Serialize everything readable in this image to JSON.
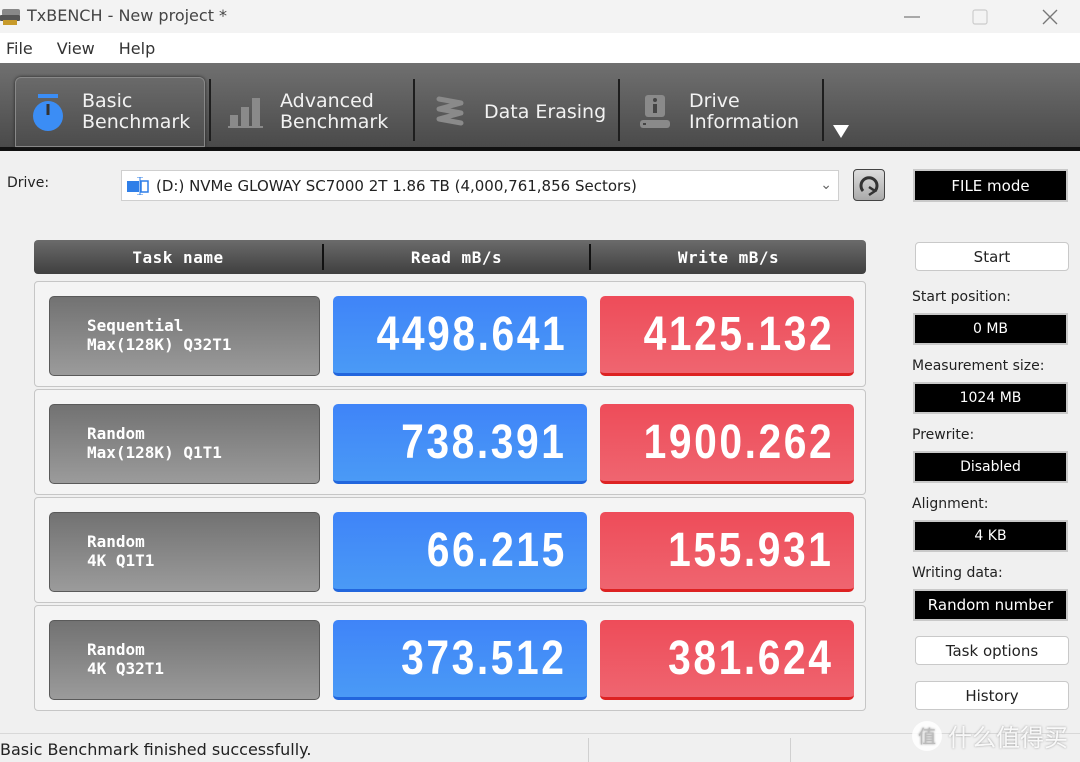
{
  "window": {
    "title": "TxBENCH - New project *",
    "minimize_icon": "minimize-icon",
    "maximize_icon": "maximize-icon",
    "close_icon": "close-icon"
  },
  "menu": [
    "File",
    "View",
    "Help"
  ],
  "tabs": [
    {
      "label_line1": "Basic",
      "label_line2": "Benchmark",
      "icon": "stopwatch-icon",
      "active": true
    },
    {
      "label_line1": "Advanced",
      "label_line2": "Benchmark",
      "icon": "bar-chart-icon",
      "active": false
    },
    {
      "label_line1": "Data Erasing",
      "label_line2": "",
      "icon": "eraser-spring-icon",
      "active": false
    },
    {
      "label_line1": "Drive",
      "label_line2": "Information",
      "icon": "drive-info-icon",
      "active": false
    }
  ],
  "drive": {
    "label": "Drive:",
    "selected": "(D:) NVMe GLOWAY SC7000 2T  1.86 TB (4,000,761,856 Sectors)",
    "mode": "FILE mode"
  },
  "table": {
    "headers": [
      "Task name",
      "Read mB/s",
      "Write mB/s"
    ],
    "rows": [
      {
        "name_line1": "Sequential",
        "name_line2": "Max(128K) Q32T1",
        "read": "4498.641",
        "write": "4125.132"
      },
      {
        "name_line1": "Random",
        "name_line2": "Max(128K) Q1T1",
        "read": "738.391",
        "write": "1900.262"
      },
      {
        "name_line1": "Random",
        "name_line2": "4K Q1T1",
        "read": "66.215",
        "write": "155.931"
      },
      {
        "name_line1": "Random",
        "name_line2": "4K Q32T1",
        "read": "373.512",
        "write": "381.624"
      }
    ]
  },
  "side": {
    "start_label": "Start",
    "start_position_label": "Start position:",
    "start_position": "0 MB",
    "measurement_size_label": "Measurement size:",
    "measurement_size": "1024 MB",
    "prewrite_label": "Prewrite:",
    "prewrite": "Disabled",
    "alignment_label": "Alignment:",
    "alignment": "4 KB",
    "writing_data_label": "Writing data:",
    "writing_data": "Random number",
    "task_options_label": "Task options",
    "history_label": "History"
  },
  "status": {
    "message": "Basic Benchmark finished successfully."
  },
  "watermark": {
    "badge": "值",
    "text": "什么值得买"
  },
  "colors": {
    "read": "#4a90f5",
    "write": "#ee5560",
    "active_icon": "#3b8df5"
  }
}
